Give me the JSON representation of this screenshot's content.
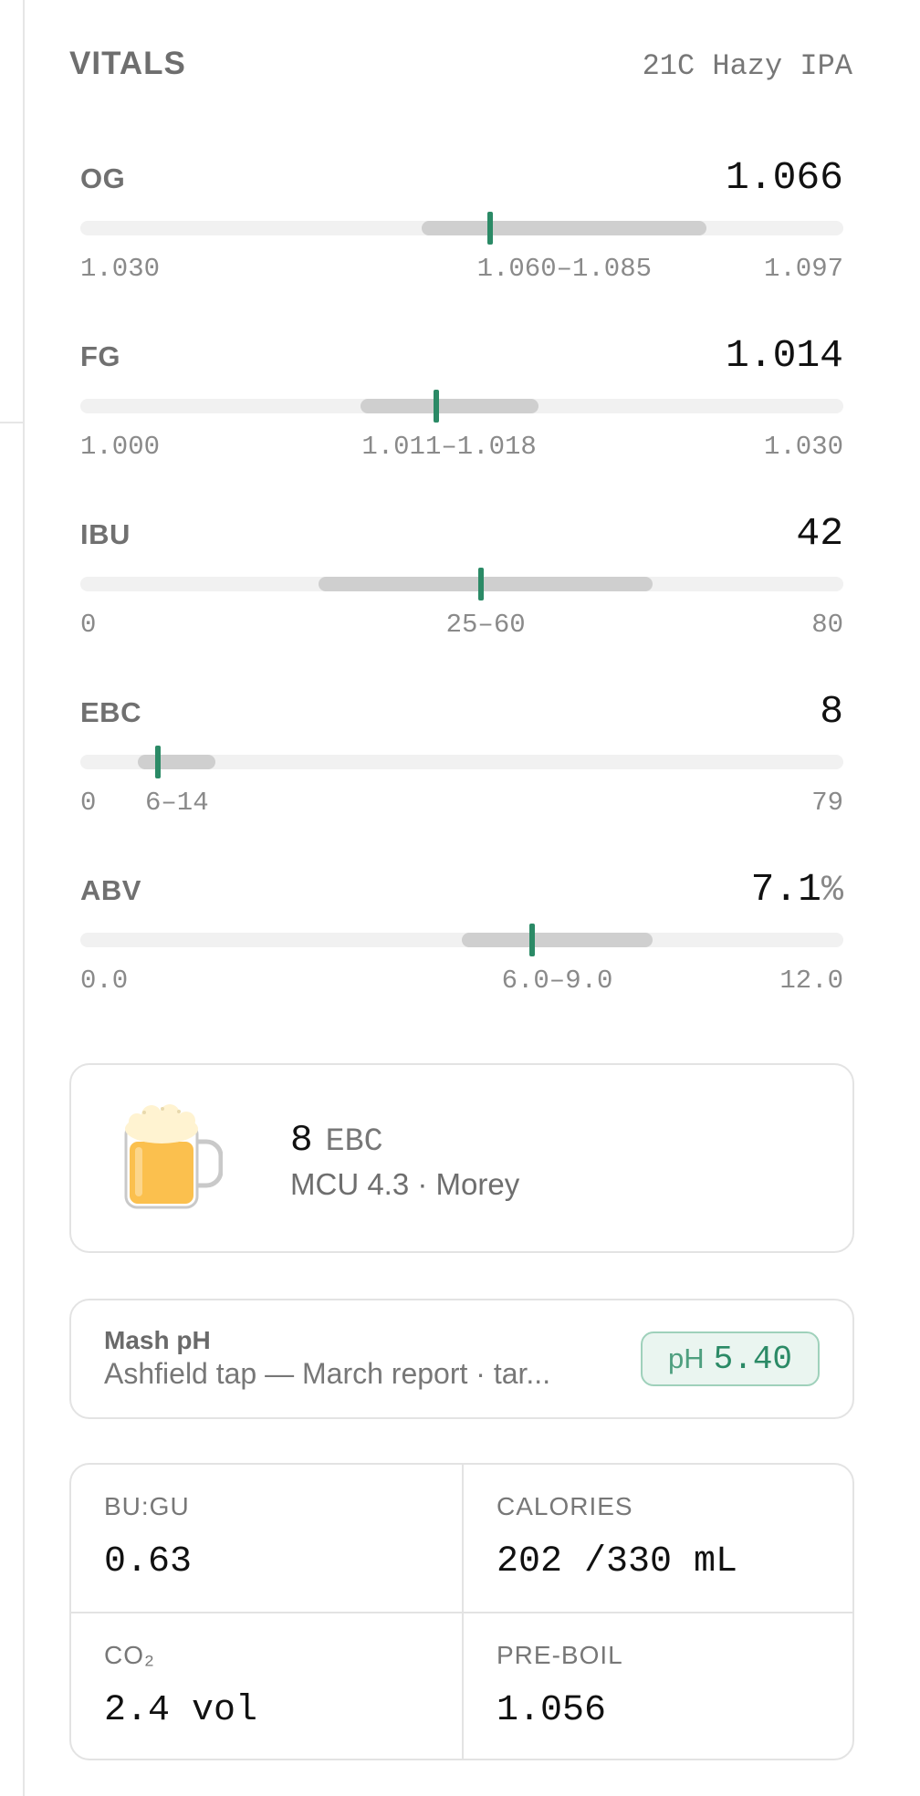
{
  "header": {
    "title": "VITALS",
    "recipe": "21C Hazy IPA"
  },
  "accent_color": "#2b8a66",
  "vitals": [
    {
      "label": "OG",
      "value": "1.066",
      "unit": "",
      "min_label": "1.030",
      "range_label": "1.060–1.085",
      "max_label": "1.097",
      "min": 1.03,
      "max": 1.097,
      "range_low": 1.06,
      "range_high": 1.085,
      "current": 1.066
    },
    {
      "label": "FG",
      "value": "1.014",
      "unit": "",
      "min_label": "1.000",
      "range_label": "1.011–1.018",
      "max_label": "1.030",
      "min": 1.0,
      "max": 1.03,
      "range_low": 1.011,
      "range_high": 1.018,
      "current": 1.014
    },
    {
      "label": "IBU",
      "value": "42",
      "unit": "",
      "min_label": "0",
      "range_label": "25–60",
      "max_label": "80",
      "min": 0,
      "max": 80,
      "range_low": 25,
      "range_high": 60,
      "current": 42
    },
    {
      "label": "EBC",
      "value": "8",
      "unit": "",
      "min_label": "0",
      "range_label": "6–14",
      "max_label": "79",
      "min": 0,
      "max": 79,
      "range_low": 6,
      "range_high": 14,
      "current": 8
    },
    {
      "label": "ABV",
      "value": "7.1",
      "unit": "%",
      "min_label": "0.0",
      "range_label": "6.0–9.0",
      "max_label": "12.0",
      "min": 0,
      "max": 12,
      "range_low": 6.0,
      "range_high": 9.0,
      "current": 7.1
    }
  ],
  "color_card": {
    "value": "8",
    "unit": "EBC",
    "detail": "MCU 4.3 · Morey",
    "beer_color": "#fbc04e"
  },
  "mash_ph": {
    "title": "Mash pH",
    "subtitle": "Ashfield tap — March report · tar...",
    "badge_prefix": "pH",
    "badge_value": "5.40"
  },
  "stats": [
    {
      "key": "BU:GU",
      "value": "0.63"
    },
    {
      "key": "CALORIES",
      "value": "202 /330 mL"
    },
    {
      "key": "CO₂",
      "value": "2.4 vol"
    },
    {
      "key": "PRE-BOIL",
      "value": "1.056"
    }
  ]
}
